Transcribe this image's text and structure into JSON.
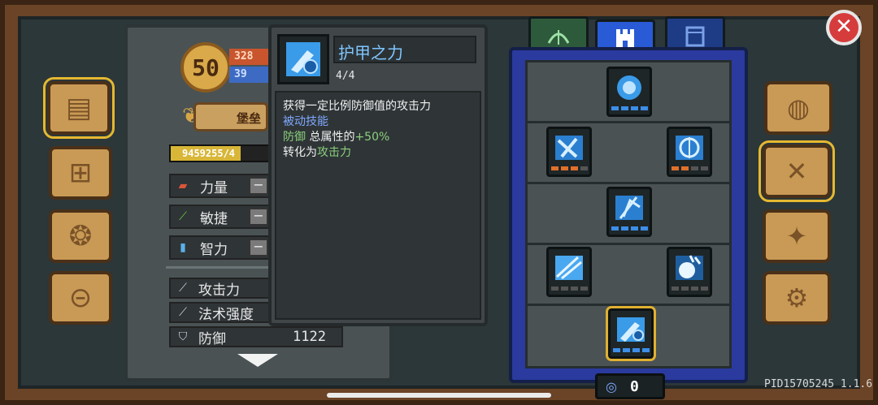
{
  "player": {
    "level": "50",
    "hp": "328",
    "mp": "39",
    "title": "堡垒",
    "exp_text": "9459255/4",
    "exp_fraction": 0.72
  },
  "stats": [
    {
      "label": "力量",
      "icon": "fist-icon"
    },
    {
      "label": "敏捷",
      "icon": "feather-icon"
    },
    {
      "label": "智力",
      "icon": "book-icon"
    }
  ],
  "attributes": [
    {
      "label": "攻击力",
      "value": "",
      "icon": "sword-icon"
    },
    {
      "label": "法术强度",
      "value": "",
      "icon": "wand-icon"
    },
    {
      "label": "防御",
      "value": "1122",
      "icon": "shield-icon"
    }
  ],
  "tooltip": {
    "name": "护甲之力",
    "level": "4/4",
    "line1": "获得一定比例防御值的攻击力",
    "line2": "被动技能",
    "line3_a": "防御",
    "line3_b": "总属性的",
    "line3_c": "+50%",
    "line4_a": "转化为",
    "line4_b": "攻击力"
  },
  "skill_points": "0",
  "pid": "PID15705245 1.1.6",
  "close_symbol": "✕",
  "colors": {
    "tab_active": "#2a5bd6",
    "pip_blue": "#3c8ee8",
    "pip_orange": "#e0702a"
  }
}
